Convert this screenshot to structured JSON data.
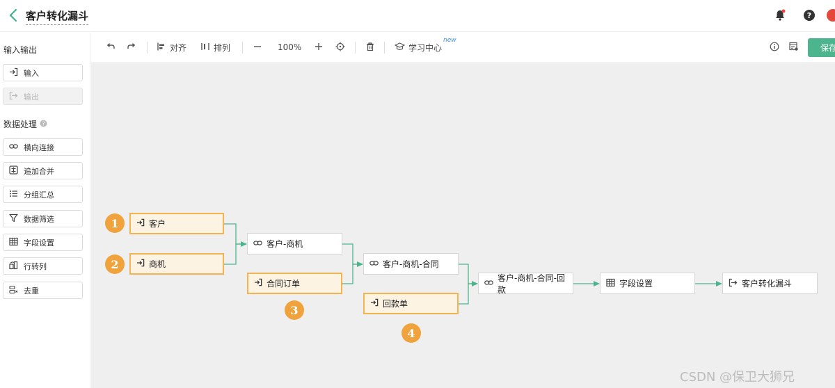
{
  "header": {
    "title": "客户转化漏斗"
  },
  "sidebar": {
    "io_title": "输入输出",
    "io_items": [
      {
        "label": "输入",
        "icon": "login-arrow-icon",
        "disabled": false
      },
      {
        "label": "输出",
        "icon": "logout-arrow-icon",
        "disabled": true
      }
    ],
    "process_title": "数据处理",
    "process_items": [
      {
        "label": "横向连接",
        "icon": "link-icon"
      },
      {
        "label": "追加合并",
        "icon": "merge-icon"
      },
      {
        "label": "分组汇总",
        "icon": "list-icon"
      },
      {
        "label": "数据筛选",
        "icon": "filter-icon"
      },
      {
        "label": "字段设置",
        "icon": "table-icon"
      },
      {
        "label": "行转列",
        "icon": "transpose-icon"
      },
      {
        "label": "去重",
        "icon": "dedupe-icon"
      }
    ]
  },
  "toolbar": {
    "align_label": "对齐",
    "arrange_label": "排列",
    "zoom": "100%",
    "learn_label": "学习中心",
    "new_badge": "new",
    "save_label": "保存"
  },
  "flow": {
    "nodes": [
      {
        "id": "kehu",
        "label": "客户",
        "kind": "input",
        "icon": "login-arrow-icon"
      },
      {
        "id": "shangji",
        "label": "商机",
        "kind": "input",
        "icon": "login-arrow-icon"
      },
      {
        "id": "hetong",
        "label": "合同订单",
        "kind": "input",
        "icon": "login-arrow-icon"
      },
      {
        "id": "huikuan",
        "label": "回款单",
        "kind": "input",
        "icon": "login-arrow-icon"
      },
      {
        "id": "join1",
        "label": "客户-商机",
        "kind": "join",
        "icon": "link-icon"
      },
      {
        "id": "join2",
        "label": "客户-商机-合同",
        "kind": "join",
        "icon": "link-icon"
      },
      {
        "id": "join3",
        "label": "客户-商机-合同-回款",
        "kind": "join",
        "icon": "link-icon"
      },
      {
        "id": "fields",
        "label": "字段设置",
        "kind": "field",
        "icon": "table-icon"
      },
      {
        "id": "output",
        "label": "客户转化漏斗",
        "kind": "output",
        "icon": "logout-arrow-icon"
      }
    ],
    "markers": [
      "1",
      "2",
      "3",
      "4"
    ]
  },
  "watermark": "CSDN @保卫大狮兄",
  "colors": {
    "accent": "#4cb58d",
    "input_border": "#f2b350",
    "marker": "#f0a33c",
    "edge": "#4cb58d"
  }
}
